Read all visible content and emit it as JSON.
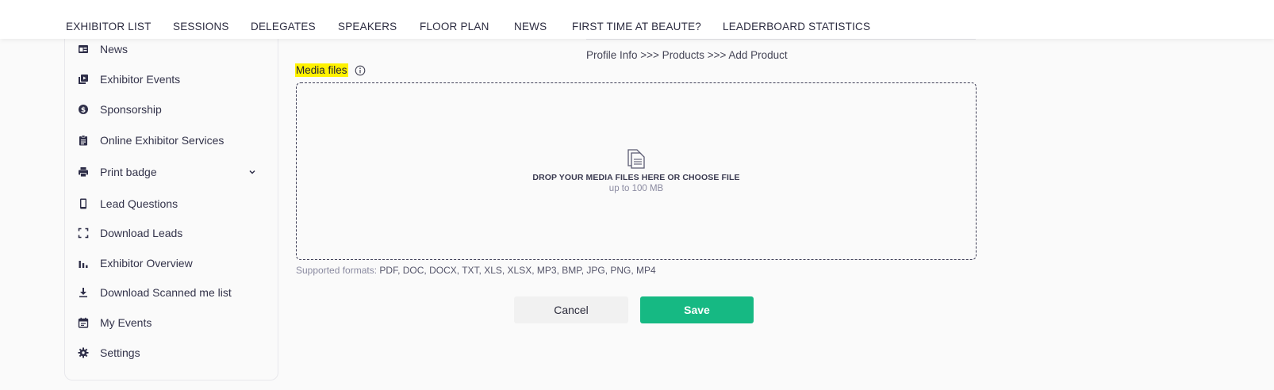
{
  "nav": {
    "items": [
      "EXHIBITOR LIST",
      "SESSIONS",
      "DELEGATES",
      "SPEAKERS",
      "FLOOR PLAN",
      "NEWS",
      "FIRST TIME AT BEAUTE?",
      "LEADERBOARD STATISTICS"
    ]
  },
  "sidebar": {
    "items": [
      {
        "label": "News",
        "icon": "news-icon"
      },
      {
        "label": "Exhibitor Events",
        "icon": "video-library-icon"
      },
      {
        "label": "Sponsorship",
        "icon": "dollar-icon"
      },
      {
        "label": "Online Exhibitor Services",
        "icon": "clipboard-icon"
      },
      {
        "label": "Print badge",
        "icon": "printer-icon"
      },
      {
        "label": "Lead Questions",
        "icon": "phone-icon"
      },
      {
        "label": "Download Leads",
        "icon": "scan-icon"
      },
      {
        "label": "Exhibitor Overview",
        "icon": "bar-chart-icon"
      },
      {
        "label": "Download Scanned me list",
        "icon": "download-icon"
      },
      {
        "label": "My Events",
        "icon": "calendar-icon"
      },
      {
        "label": "Settings",
        "icon": "gear-icon"
      }
    ]
  },
  "breadcrumb": "Profile Info >>> Products >>> Add Product",
  "media": {
    "label": "Media files",
    "dropzone_title": "DROP YOUR MEDIA FILES HERE OR CHOOSE FILE",
    "dropzone_subtitle": "up to 100 MB",
    "formats_prefix": "Supported formats:",
    "formats_list": "PDF, DOC, DOCX, TXT, XLS, XLSX, MP3, BMP, JPG, PNG, MP4"
  },
  "buttons": {
    "cancel": "Cancel",
    "save": "Save"
  },
  "colors": {
    "accent": "#16b983",
    "highlight": "#fff200"
  }
}
